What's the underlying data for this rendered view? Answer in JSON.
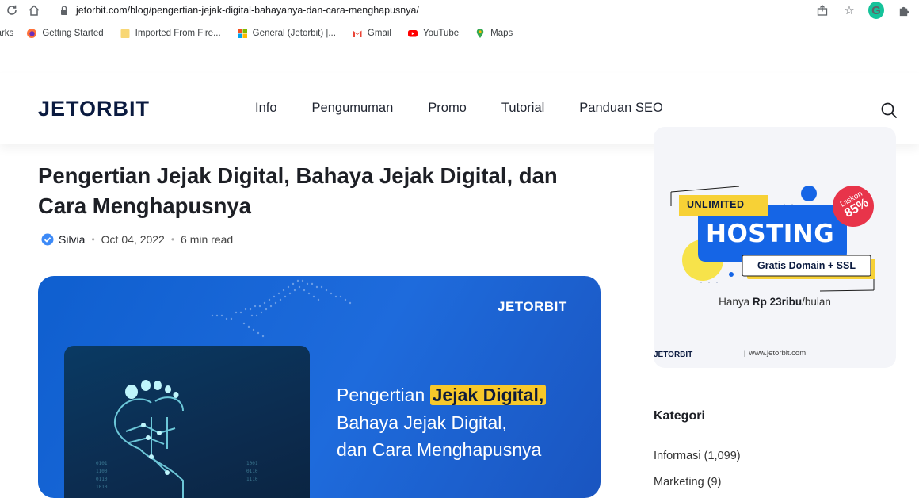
{
  "browser": {
    "url": "jetorbit.com/blog/pengertian-jejak-digital-bahayanya-dan-cara-menghapusnya/",
    "bookmarks": [
      {
        "label": "marks",
        "icon": "none"
      },
      {
        "label": "Getting Started",
        "icon": "firefox-icon"
      },
      {
        "label": "Imported From Fire...",
        "icon": "folder-icon"
      },
      {
        "label": "General (Jetorbit) |...",
        "icon": "microsoft-icon"
      },
      {
        "label": "Gmail",
        "icon": "gmail-icon"
      },
      {
        "label": "YouTube",
        "icon": "youtube-icon"
      },
      {
        "label": "Maps",
        "icon": "maps-icon"
      }
    ]
  },
  "site": {
    "nav": [
      "Info",
      "Pengumuman",
      "Promo",
      "Tutorial",
      "Panduan SEO"
    ]
  },
  "article": {
    "title": "Pengertian Jejak Digital, Bahaya Jejak Digital, dan Cara Menghapusnya",
    "author": "Silvia",
    "date": "Oct 04, 2022",
    "read_time": "6 min read",
    "hero": {
      "headline_pre": "Pengertian ",
      "headline_highlight": "Jejak Digital,",
      "headline_line2": "Bahaya Jejak Digital,",
      "headline_line3": "dan Cara Menghapusnya"
    }
  },
  "sidebar": {
    "ad": {
      "badge": "UNLIMITED",
      "title": "HOSTING",
      "discount_label": "Diskon",
      "discount_value": "85%",
      "subtitle": "Gratis Domain + SSL",
      "price_pre": "Hanya ",
      "price_bold": "Rp 23ribu",
      "price_post": "/bulan",
      "footer_url": "www.jetorbit.com"
    },
    "category_title": "Kategori",
    "categories": [
      "Informasi (1,099)",
      "Marketing (9)"
    ]
  },
  "colors": {
    "brand_dark": "#0a1a3f",
    "brand_blue": "#1565e6",
    "highlight_yellow": "#f7c82a",
    "discount_red": "#e8344a"
  }
}
